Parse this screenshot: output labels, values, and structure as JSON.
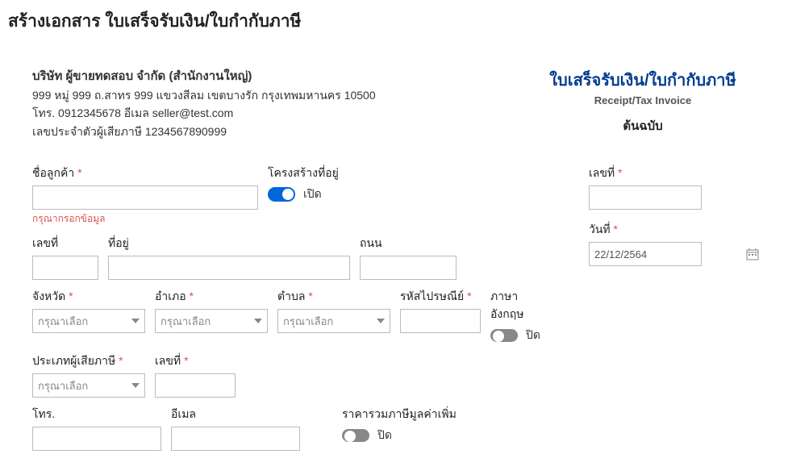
{
  "page_title": "สร้างเอกสาร ใบเสร็จรับเงิน/ใบกำกับภาษี",
  "seller": {
    "name": "บริษัท ผู้ขายทดสอบ จำกัด (สำนักงานใหญ่)",
    "address": "999 หมู่ 999 ถ.สาทร 999 แขวงสีลม เขตบางรัก กรุงเทพมหานคร 10500",
    "contact": "โทร. 0912345678 อีเมล seller@test.com",
    "taxid_line": "เลขประจำตัวผู้เสียภาษี 1234567890999"
  },
  "doc": {
    "title_th": "ใบเสร็จรับเงิน/ใบกำกับภาษี",
    "title_en": "Receipt/Tax Invoice",
    "copy_label": "ต้นฉบับ"
  },
  "labels": {
    "customer_name": "ชื่อลูกค้า",
    "address_structure": "โครงสร้างที่อยู่",
    "open": "เปิด",
    "closed": "ปิด",
    "no": "เลขที่",
    "date": "วันที่",
    "date_value": "22/12/2564",
    "address": "ที่อยู่",
    "road": "ถนน",
    "province": "จังหวัด",
    "district": "อำเภอ",
    "subdistrict": "ตำบล",
    "postcode": "รหัสไปรษณีย์",
    "english_lang": "ภาษาอังกฤษ",
    "taxpayer_type": "ประเภทผู้เสียภาษี",
    "no2": "เลขที่",
    "tel": "โทร.",
    "email": "อีเมล",
    "price_vat_incl": "ราคารวมภาษีมูลค่าเพิ่ม",
    "please_select": "กรุณาเลือก",
    "please_fill": "กรุณากรอกข้อมูล"
  }
}
